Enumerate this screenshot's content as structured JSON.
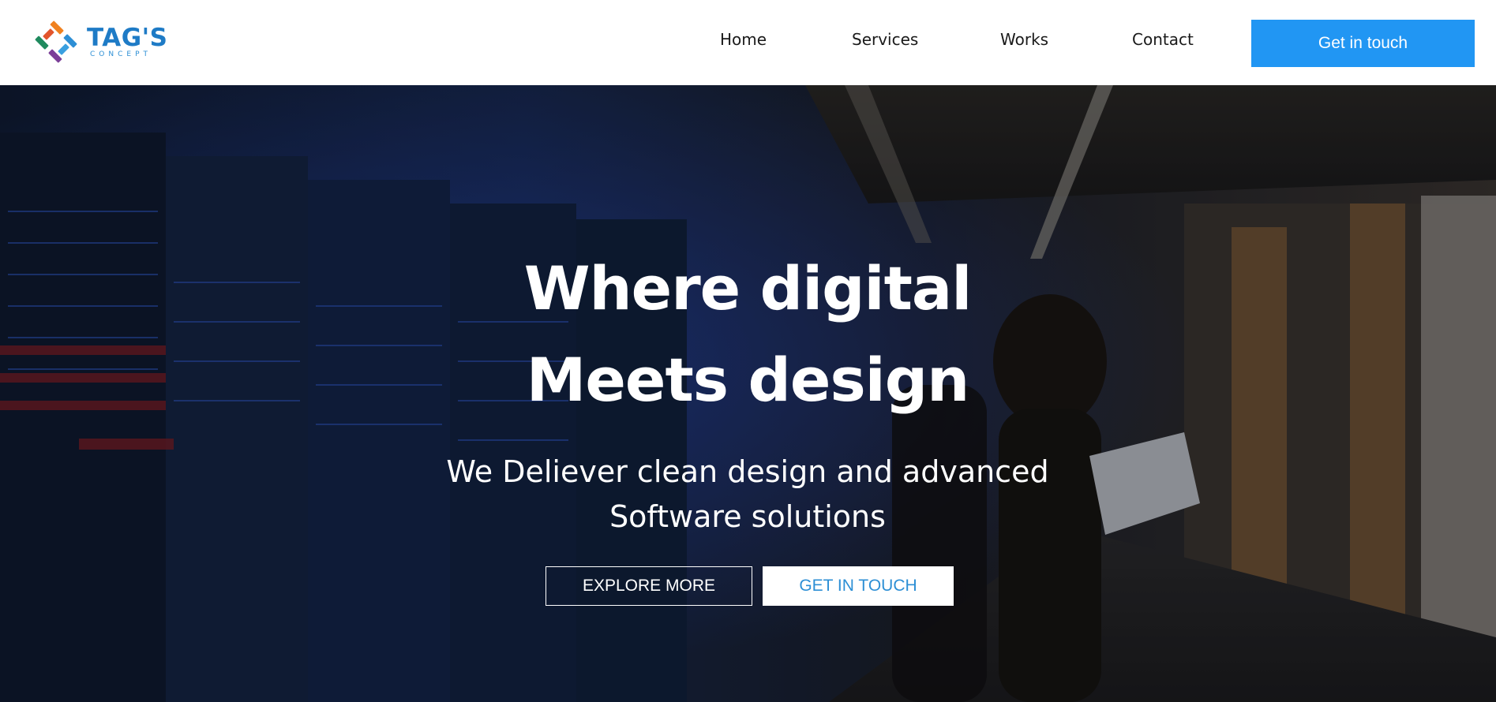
{
  "brand": {
    "name": "TAG'S",
    "tagline": "CONCEPT",
    "colors": {
      "brand_blue": "#1e7bc6",
      "accent_blue": "#2196f3",
      "logo_orange": "#f0811f",
      "logo_blue": "#2d8fd5",
      "logo_purple": "#7b3f98",
      "logo_green": "#1f8a5e"
    },
    "logo_icon": "interlocking-squares-logo-icon"
  },
  "nav": {
    "items": [
      {
        "label": "Home"
      },
      {
        "label": "Services"
      },
      {
        "label": "Works"
      },
      {
        "label": "Contact"
      }
    ],
    "cta_label": "Get in touch"
  },
  "hero": {
    "title_line1": "Where digital",
    "title_line2": "Meets design",
    "subtitle_line1": "We Deliever clean design and advanced",
    "subtitle_line2": "Software solutions",
    "explore_label": "EXPLORE MORE",
    "touch_label": "GET IN TOUCH",
    "background": "server-room-woman-with-laptop-photo"
  }
}
